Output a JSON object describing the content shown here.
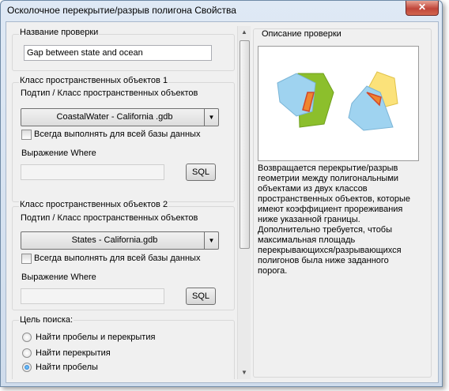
{
  "window": {
    "title": "Осколочное перекрытие/разрыв полигона Свойства",
    "close_glyph": "✕"
  },
  "check_name": {
    "label": "Название проверки",
    "value": "Gap between state and ocean"
  },
  "feature_class_1": {
    "label": "Класс пространственных объектов 1",
    "subtype_label": "Подтип / Класс пространственных объектов",
    "selected": "CoastalWater - California .gdb",
    "always_run_label": "Всегда выполнять для всей базы данных",
    "always_run_checked": false,
    "where_label": "Выражение Where",
    "where_value": "",
    "sql_button": "SQL"
  },
  "feature_class_2": {
    "label": "Класс пространственных объектов 2",
    "subtype_label": "Подтип / Класс пространственных объектов",
    "selected": "States -  California.gdb",
    "always_run_label": "Всегда выполнять для всей базы данных",
    "always_run_checked": false,
    "where_label": "Выражение Where",
    "where_value": "",
    "sql_button": "SQL"
  },
  "search_goal": {
    "label": "Цель поиска:",
    "options": [
      {
        "label": "Найти пробелы и перекрытия",
        "checked": false
      },
      {
        "label": "Найти перекрытия",
        "checked": false
      },
      {
        "label": "Найти пробелы",
        "checked": true
      }
    ]
  },
  "description": {
    "label": "Описание проверки",
    "text": "Возвращается перекрытие/разрыв геометрии между полигональными объектами из двух классов пространственных объектов, которые имеют коэффициент прореживания ниже указанной границы. Дополнительно требуется, чтобы максимальная площадь перекрывающихся/разрывающихся полигонов была ниже заданного порога."
  },
  "colors": {
    "polygon_blue": "#9fd3f0",
    "polygon_green": "#8cbf2c",
    "polygon_yellow": "#fbe27a",
    "sliver_orange": "#f0852f",
    "sliver_outline": "#d2482a",
    "radio_selected": "#1a66c7"
  },
  "icons": {
    "combo_arrow": "▼",
    "scroll_up": "▲",
    "scroll_down": "▼"
  }
}
